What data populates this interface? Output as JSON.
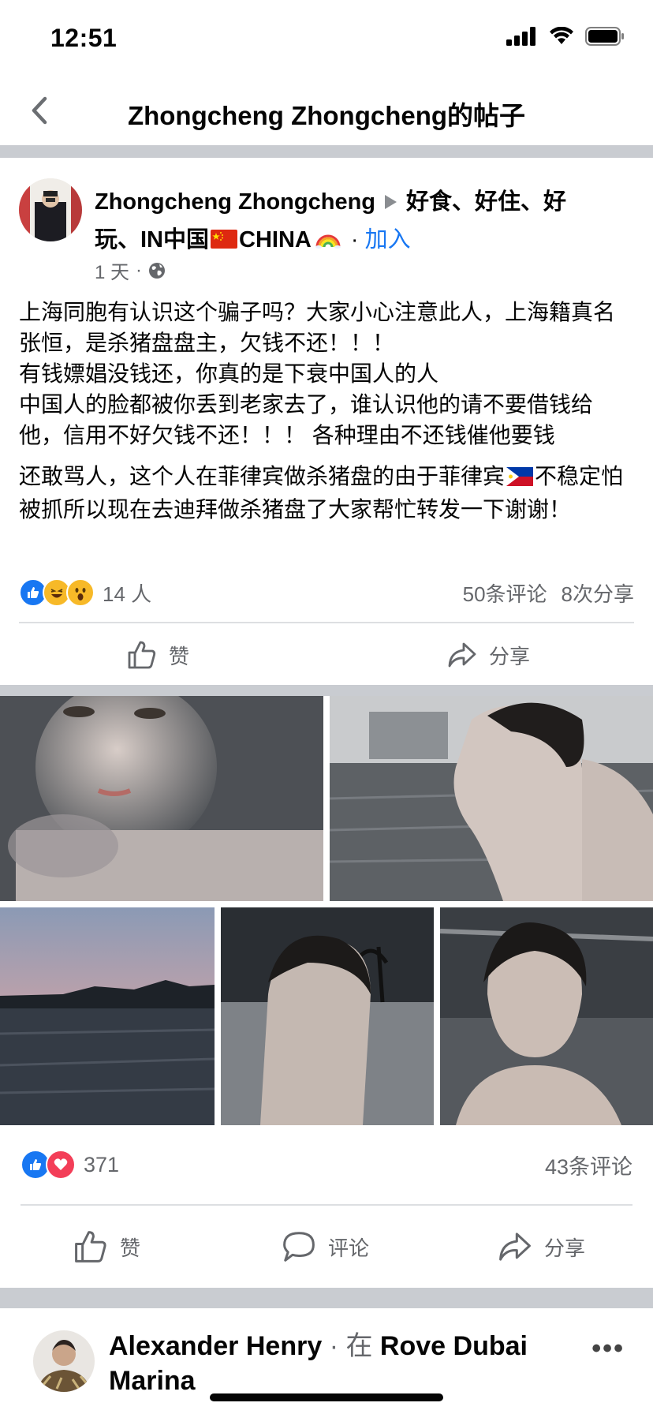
{
  "status_bar": {
    "time": "12:51"
  },
  "header": {
    "title": "Zhongcheng Zhongcheng的帖子"
  },
  "post": {
    "author": "Zhongcheng Zhongcheng",
    "group_part1": "好食、好住、好玩、IN中国",
    "group_part2": "CHINA",
    "separator": "·",
    "join_label": "加入",
    "time": "1 天",
    "meta_separator": "·",
    "body": [
      "上海同胞有认识这个骗子吗？大家小心注意此人，上海籍真名张恒，是杀猪盘盘主，欠钱不还！！！",
      "有钱嫖娼没钱还，你真的是下衰中国人的人",
      "中国人的脸都被你丢到老家去了，谁认识他的请不要借钱给他，信用不好欠钱不还！！！ 各种理由不还钱催他要钱",
      "还敢骂人，这个人在菲律宾做杀猪盘的由于菲律宾",
      "不稳定怕被抓所以现在去迪拜做杀猪盘了大家帮忙转发一下谢谢！"
    ],
    "reactions_count": "14 人",
    "comments": "50条评论",
    "shares": "8次分享",
    "like_label": "赞",
    "share_label": "分享",
    "colors": {
      "link": "#1877f2",
      "muted": "#65676b"
    }
  },
  "photo_post": {
    "reactions_count": "371",
    "comments": "43条评论",
    "like_label": "赞",
    "comment_label": "评论",
    "share_label": "分享"
  },
  "next_post": {
    "author": "Alexander Henry",
    "at_sep": "· 在",
    "place_line1": "Rove Dubai",
    "place_line2": "Marina"
  }
}
